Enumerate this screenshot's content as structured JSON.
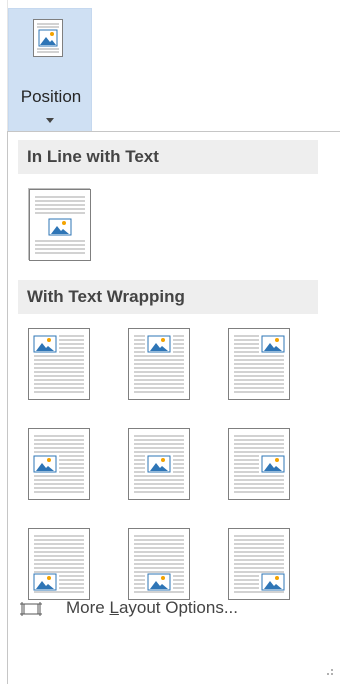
{
  "ribbon": {
    "button_label": "Position",
    "icon": "position-picture-icon",
    "caret": "dropdown-caret-icon"
  },
  "menu": {
    "section_inline": {
      "label": "In Line with Text",
      "tiles": [
        {
          "name": "in-line-with-text",
          "selected": true
        }
      ]
    },
    "section_wrapping": {
      "label": "With Text Wrapping",
      "tiles": [
        {
          "name": "top-left",
          "vertical": "top",
          "horizontal": "left"
        },
        {
          "name": "top-center",
          "vertical": "top",
          "horizontal": "center"
        },
        {
          "name": "top-right",
          "vertical": "top",
          "horizontal": "right"
        },
        {
          "name": "middle-left",
          "vertical": "middle",
          "horizontal": "left"
        },
        {
          "name": "middle-center",
          "vertical": "middle",
          "horizontal": "center"
        },
        {
          "name": "middle-right",
          "vertical": "middle",
          "horizontal": "right"
        },
        {
          "name": "bottom-left",
          "vertical": "bottom",
          "horizontal": "left"
        },
        {
          "name": "bottom-center",
          "vertical": "bottom",
          "horizontal": "center"
        },
        {
          "name": "bottom-right",
          "vertical": "bottom",
          "horizontal": "right"
        }
      ]
    },
    "more_options": {
      "label_before": "More ",
      "label_accel": "L",
      "label_after": "ayout Options...",
      "icon": "layout-options-icon"
    }
  },
  "colors": {
    "ribbon_highlight": "#cfe0f3",
    "header_bg": "#eeeeee",
    "picture_blue": "#2e75b6",
    "sun_orange": "#f4a300",
    "line_gray": "#a6a6a6"
  }
}
